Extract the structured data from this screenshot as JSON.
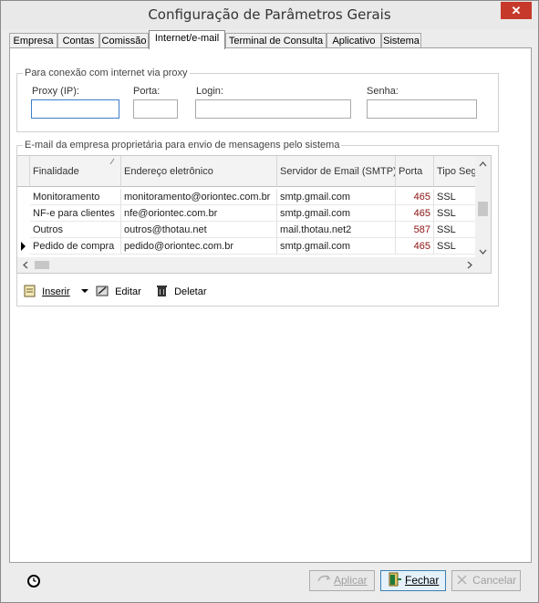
{
  "window": {
    "title": "Configuração de Parâmetros Gerais",
    "close_symbol": "✕"
  },
  "tabs": [
    {
      "label": "Empresa"
    },
    {
      "label": "Contas"
    },
    {
      "label": "Comissão"
    },
    {
      "label": "Internet/e-mail"
    },
    {
      "label": "Terminal de Consulta"
    },
    {
      "label": "Aplicativo"
    },
    {
      "label": "Sistema"
    }
  ],
  "proxy": {
    "group_label": "Para conexão com internet via proxy",
    "ip_label": "Proxy (IP):",
    "port_label": "Porta:",
    "login_label": "Login:",
    "password_label": "Senha:",
    "ip_value": "",
    "port_value": "",
    "login_value": "",
    "password_value": ""
  },
  "email": {
    "group_label": "E-mail da empresa proprietária para envio de mensagens pelo sistema",
    "columns": [
      "Finalidade",
      "Endereço eletrônico",
      "Servidor de Email (SMTP)",
      "Porta",
      "Tipo Segu"
    ],
    "rows": [
      {
        "finalidade": "Monitoramento",
        "endereco": "monitoramento@oriontec.com.br",
        "servidor": "smtp.gmail.com",
        "porta": "465",
        "tipo": "SSL",
        "current": false
      },
      {
        "finalidade": "NF-e para clientes",
        "endereco": "nfe@oriontec.com.br",
        "servidor": "smtp.gmail.com",
        "porta": "465",
        "tipo": "SSL",
        "current": false
      },
      {
        "finalidade": "Outros",
        "endereco": "outros@thotau.net",
        "servidor": "mail.thotau.net2",
        "porta": "587",
        "tipo": "SSL",
        "current": false
      },
      {
        "finalidade": "Pedido de compra",
        "endereco": "pedido@oriontec.com.br",
        "servidor": "smtp.gmail.com",
        "porta": "465",
        "tipo": "SSL",
        "current": true
      }
    ],
    "toolbar": {
      "insert": "Inserir",
      "edit": "Editar",
      "delete": "Deletar"
    }
  },
  "buttons": {
    "apply": "Aplicar",
    "close": "Fechar",
    "cancel": "Cancelar"
  },
  "colors": {
    "accent": "#3e7ec9",
    "port_text": "#8b1010",
    "close_button": "#c7392b"
  }
}
